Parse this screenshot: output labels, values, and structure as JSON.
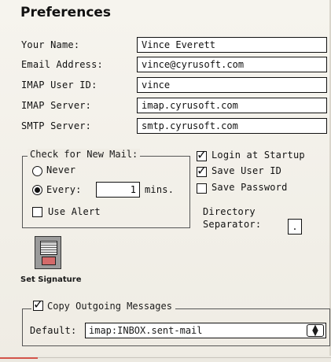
{
  "window": {
    "title": "Preferences"
  },
  "fields": [
    {
      "label": "Your Name:",
      "value": "Vince Everett"
    },
    {
      "label": "Email Address:",
      "value": "vince@cyrusoft.com"
    },
    {
      "label": "IMAP User ID:",
      "value": "vince"
    },
    {
      "label": "IMAP Server:",
      "value": "imap.cyrusoft.com"
    },
    {
      "label": "SMTP Server:",
      "value": "smtp.cyrusoft.com"
    }
  ],
  "check_mail": {
    "title": "Check for New Mail:",
    "never_label": "Never",
    "every_label": "Every:",
    "every_value": "1",
    "mins_label": "mins.",
    "use_alert_label": "Use Alert",
    "selected": "every",
    "use_alert": false
  },
  "options": {
    "login_at_startup": {
      "label": "Login at Startup",
      "checked": true
    },
    "save_user_id": {
      "label": "Save User ID",
      "checked": true
    },
    "save_password": {
      "label": "Save Password",
      "checked": false
    }
  },
  "directory_separator": {
    "label_line1": "Directory",
    "label_line2": "Separator:",
    "value": "."
  },
  "signature": {
    "label": "Set Signature",
    "icon": "signature-icon"
  },
  "outgoing": {
    "title": "Copy Outgoing Messages",
    "checked": true,
    "default_label": "Default:",
    "default_value": "imap:INBOX.sent-mail"
  }
}
